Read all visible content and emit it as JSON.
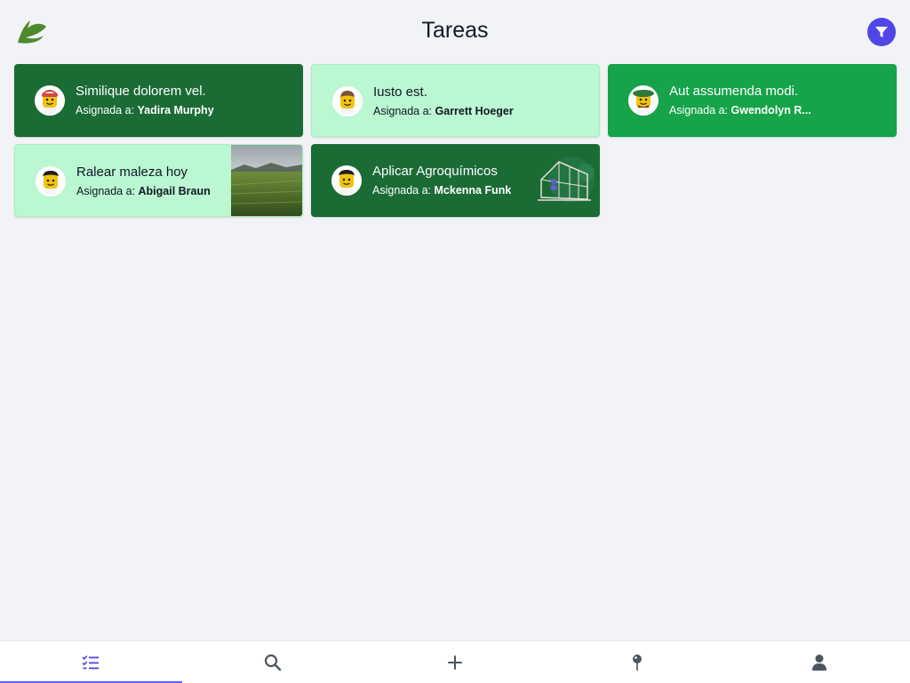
{
  "header": {
    "title": "Tareas",
    "logo_icon": "brand-leaf-logo",
    "filter_icon": "filter-icon"
  },
  "tasks": [
    {
      "title": "Similique dolorem vel.",
      "assigned_prefix": "Asignada a:",
      "assignee": "Yadira Murphy",
      "style": "dark",
      "has_image": false
    },
    {
      "title": "Iusto est.",
      "assigned_prefix": "Asignada a:",
      "assignee": "Garrett Hoeger",
      "style": "light",
      "has_image": false
    },
    {
      "title": "Aut assumenda modi.",
      "assigned_prefix": "Asignada a:",
      "assignee": "Gwendolyn R...",
      "style": "mid",
      "has_image": false
    },
    {
      "title": "Ralear maleza hoy",
      "assigned_prefix": "Asignada a:",
      "assignee": "Abigail Braun",
      "style": "light",
      "has_image": true,
      "image": "rice-field-photo"
    },
    {
      "title": "Aplicar Agroquímicos",
      "assigned_prefix": "Asignada a:",
      "assignee": "Mckenna Funk",
      "style": "dark",
      "has_image": true,
      "image": "greenhouse-illustration"
    }
  ],
  "colors": {
    "accent": "#4f46e5",
    "card_dark": "#1b6b35",
    "card_light": "#bbf7d0",
    "card_mid": "#16a34a",
    "background": "#f2f3f6"
  },
  "bottom_nav": [
    {
      "icon": "tasks-list-icon",
      "active": true
    },
    {
      "icon": "search-icon",
      "active": false
    },
    {
      "icon": "plus-icon",
      "active": false
    },
    {
      "icon": "map-pin-icon",
      "active": false
    },
    {
      "icon": "user-icon",
      "active": false
    }
  ]
}
